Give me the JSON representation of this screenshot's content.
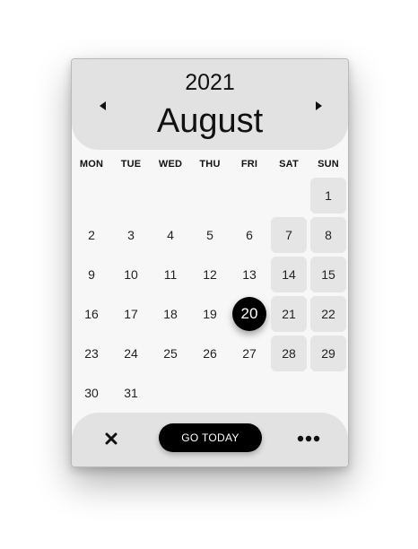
{
  "header": {
    "year": "2021",
    "month": "August",
    "prev_icon": "chevron-left-icon",
    "next_icon": "chevron-right-icon"
  },
  "weekdays": [
    "MON",
    "TUE",
    "WED",
    "THU",
    "FRI",
    "SAT",
    "SUN"
  ],
  "days": [
    {
      "label": "1",
      "col": 6,
      "row": 0,
      "weekend": true
    },
    {
      "label": "2",
      "col": 0,
      "row": 1
    },
    {
      "label": "3",
      "col": 1,
      "row": 1
    },
    {
      "label": "4",
      "col": 2,
      "row": 1
    },
    {
      "label": "5",
      "col": 3,
      "row": 1
    },
    {
      "label": "6",
      "col": 4,
      "row": 1
    },
    {
      "label": "7",
      "col": 5,
      "row": 1,
      "weekend": true
    },
    {
      "label": "8",
      "col": 6,
      "row": 1,
      "weekend": true
    },
    {
      "label": "9",
      "col": 0,
      "row": 2
    },
    {
      "label": "10",
      "col": 1,
      "row": 2
    },
    {
      "label": "11",
      "col": 2,
      "row": 2
    },
    {
      "label": "12",
      "col": 3,
      "row": 2
    },
    {
      "label": "13",
      "col": 4,
      "row": 2
    },
    {
      "label": "14",
      "col": 5,
      "row": 2,
      "weekend": true
    },
    {
      "label": "15",
      "col": 6,
      "row": 2,
      "weekend": true
    },
    {
      "label": "16",
      "col": 0,
      "row": 3
    },
    {
      "label": "17",
      "col": 1,
      "row": 3
    },
    {
      "label": "18",
      "col": 2,
      "row": 3
    },
    {
      "label": "19",
      "col": 3,
      "row": 3
    },
    {
      "label": "20",
      "col": 4,
      "row": 3,
      "selected": true
    },
    {
      "label": "21",
      "col": 5,
      "row": 3,
      "weekend": true
    },
    {
      "label": "22",
      "col": 6,
      "row": 3,
      "weekend": true
    },
    {
      "label": "23",
      "col": 0,
      "row": 4
    },
    {
      "label": "24",
      "col": 1,
      "row": 4
    },
    {
      "label": "25",
      "col": 2,
      "row": 4
    },
    {
      "label": "26",
      "col": 3,
      "row": 4
    },
    {
      "label": "27",
      "col": 4,
      "row": 4
    },
    {
      "label": "28",
      "col": 5,
      "row": 4,
      "weekend": true
    },
    {
      "label": "29",
      "col": 6,
      "row": 4,
      "weekend": true
    },
    {
      "label": "30",
      "col": 0,
      "row": 5
    },
    {
      "label": "31",
      "col": 1,
      "row": 5
    }
  ],
  "footer": {
    "close_icon": "close-icon",
    "today_label": "GO TODAY",
    "more_icon": "more-horizontal-icon"
  },
  "colors": {
    "header_bg": "#e2e2e2",
    "weekend_bg": "#e5e5e5",
    "selected_bg": "#000000",
    "accent": "#000000"
  }
}
